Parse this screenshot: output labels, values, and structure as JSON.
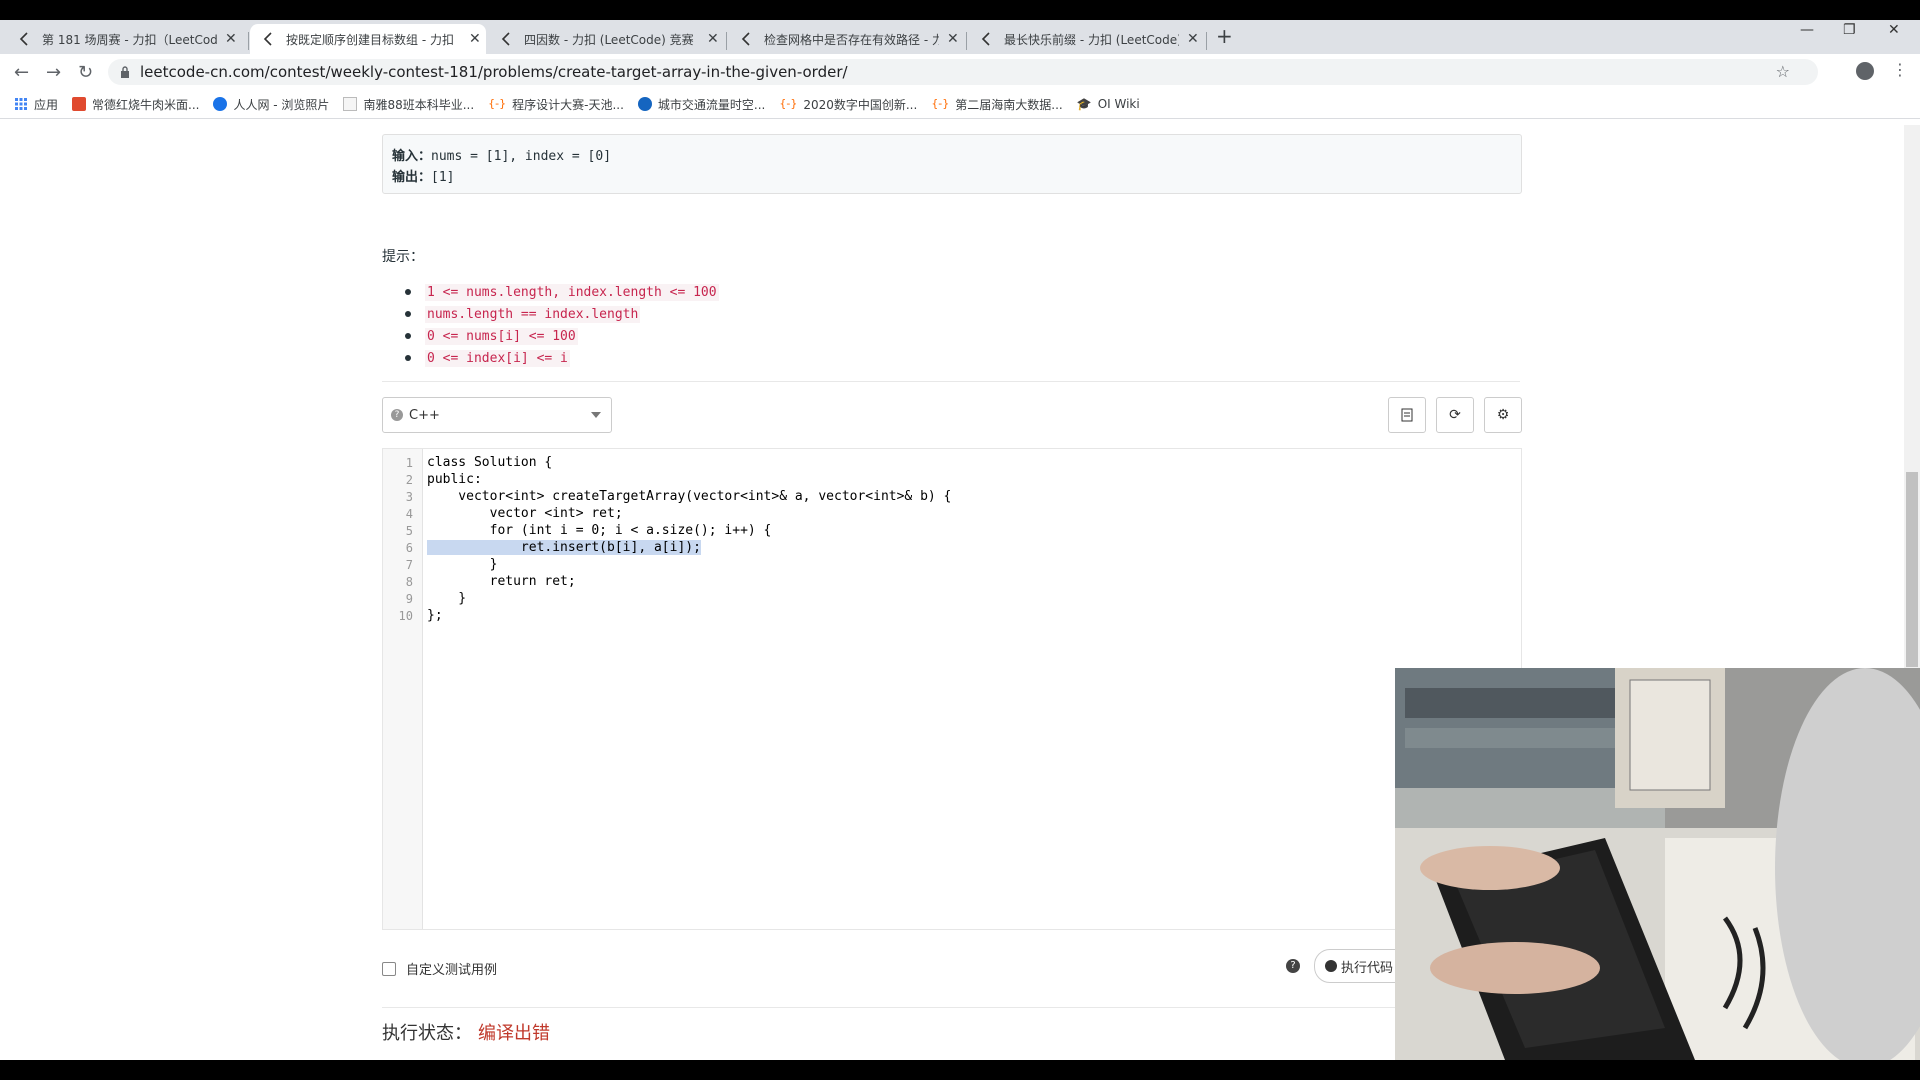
{
  "tabs": [
    {
      "title": "第 181 场周赛 - 力扣（LeetCod",
      "active": false
    },
    {
      "title": "按既定顺序创建目标数组 - 力扣",
      "active": true
    },
    {
      "title": "四因数 - 力扣 (LeetCode) 竞赛",
      "active": false
    },
    {
      "title": "检查网格中是否存在有效路径 - 力",
      "active": false
    },
    {
      "title": "最长快乐前缀 - 力扣 (LeetCode)",
      "active": false
    }
  ],
  "address_bar": {
    "url": "leetcode-cn.com/contest/weekly-contest-181/problems/create-target-array-in-the-given-order/"
  },
  "bookmarks": [
    {
      "label": "应用",
      "icon": "apps-icon"
    },
    {
      "label": "常德红烧牛肉米面...",
      "icon": "bookmark-icon"
    },
    {
      "label": "人人网 - 浏览照片",
      "icon": "renren-icon"
    },
    {
      "label": "南雅88班本科毕业...",
      "icon": "page-icon"
    },
    {
      "label": "程序设计大赛-天池...",
      "icon": "tianchi-icon"
    },
    {
      "label": "城市交通流量时空...",
      "icon": "traffic-icon"
    },
    {
      "label": "2020数字中国创新...",
      "icon": "tianchi-icon"
    },
    {
      "label": "第二届海南大数据...",
      "icon": "tianchi-icon"
    },
    {
      "label": "OI Wiki",
      "icon": "oiwiki-icon"
    }
  ],
  "example": {
    "input_label": "输入：",
    "input_value": "nums = [1], index = [0]",
    "output_label": "输出：",
    "output_value": "[1]"
  },
  "hints": {
    "title": "提示：",
    "items": [
      "1 <= nums.length, index.length <= 100",
      "nums.length == index.length",
      "0 <= nums[i] <= 100",
      "0 <= index[i] <= i"
    ]
  },
  "editor": {
    "language": "C++",
    "line_numbers": [
      "1",
      "2",
      "3",
      "4",
      "5",
      "6",
      "7",
      "8",
      "9",
      "10"
    ],
    "lines": [
      "class Solution {",
      "public:",
      "    vector<int> createTargetArray(vector<int>& a, vector<int>& b) {",
      "        vector <int> ret;",
      "        for (int i = 0; i < a.size(); i++) {",
      "            ret.insert(b[i], a[i]);",
      "        }",
      "        return ret;",
      "    }",
      "};"
    ]
  },
  "bottom": {
    "custom_test_label": "自定义测试用例",
    "run_label": "执行代码",
    "status_label": "执行状态：",
    "status_value": "编译出错"
  },
  "colors": {
    "error": "#c0392b",
    "keyword": "#0000ff",
    "hint_code": "#c7254e"
  }
}
